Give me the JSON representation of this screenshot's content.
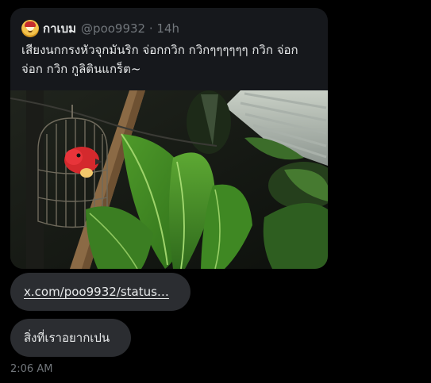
{
  "tweet": {
    "author_name": "กาเบม",
    "author_handle": "@poo9932 · 14h",
    "text": "เสียงนกกรงหัวจุกมันริก จ่อกกวิก กวิกๆๆๆๆๆๆ กวิก จ่อก จ่อก กวิก กูลิตินแกร็ต~",
    "media_alt": "photo of a birdcage with a red bird in it behind large green leaves"
  },
  "messages": [
    {
      "text": "x.com/poo9932/status…",
      "kind": "link"
    },
    {
      "text": "สิ่งที่เราอยากเปน",
      "kind": "text"
    }
  ],
  "timestamp": "2:06 AM",
  "colors": {
    "background": "#000000",
    "card": "#16181c",
    "bubble": "#2b2d31",
    "text_primary": "#e7e9ea",
    "text_secondary": "#71767b"
  }
}
